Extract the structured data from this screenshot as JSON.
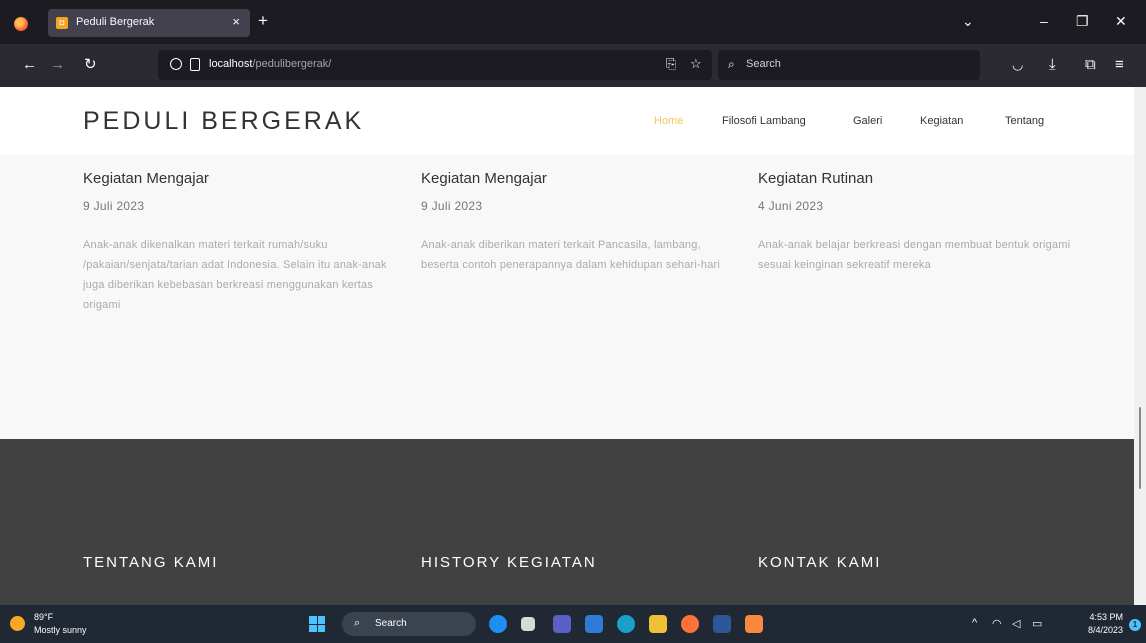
{
  "browser": {
    "tab_title": "Peduli Bergerak",
    "tab_close": "×",
    "new_tab": "+",
    "url_host": "localhost",
    "url_path": "/pedulibergerak/",
    "search_placeholder": "Search",
    "icons": [
      "firefox-logo",
      "back-arrow",
      "forward-arrow",
      "reload",
      "shield",
      "page",
      "translate",
      "star",
      "pocket",
      "download",
      "extensions",
      "menu"
    ]
  },
  "site": {
    "brand": "PEDULI BERGERAK",
    "menu": [
      {
        "label": "Home",
        "active": true
      },
      {
        "label": "Filosofi Lambang"
      },
      {
        "label": "Galeri"
      },
      {
        "label": "Kegiatan"
      },
      {
        "label": "Tentang"
      }
    ],
    "accent_color": "#f4c95d"
  },
  "activities": [
    {
      "title": "Kegiatan Mengajar",
      "date": "9 Juli 2023",
      "description": "Anak-anak dikenalkan materi terkait rumah/suku /pakaian/senjata/tarian adat Indonesia. Selain itu anak-anak juga diberikan kebebasan berkreasi menggunakan kertas origami"
    },
    {
      "title": "Kegiatan Mengajar",
      "date": "9 Juli 2023",
      "description": "Anak-anak diberikan materi terkait Pancasila, lambang, beserta contoh penerapannya dalam kehidupan sehari-hari"
    },
    {
      "title": "Kegiatan Rutinan",
      "date": "4 Juni 2023",
      "description": "Anak-anak belajar berkreasi dengan membuat bentuk origami sesuai keinginan sekreatif mereka"
    }
  ],
  "footer": {
    "headings": [
      "TENTANG KAMI",
      "HISTORY KEGIATAN",
      "KONTAK KAMI"
    ]
  },
  "taskbar": {
    "weather_temp": "89°F",
    "weather_condition": "Mostly sunny",
    "search_label": "Search",
    "time": "4:53 PM",
    "date": "8/4/2023",
    "notification_count": "1"
  }
}
